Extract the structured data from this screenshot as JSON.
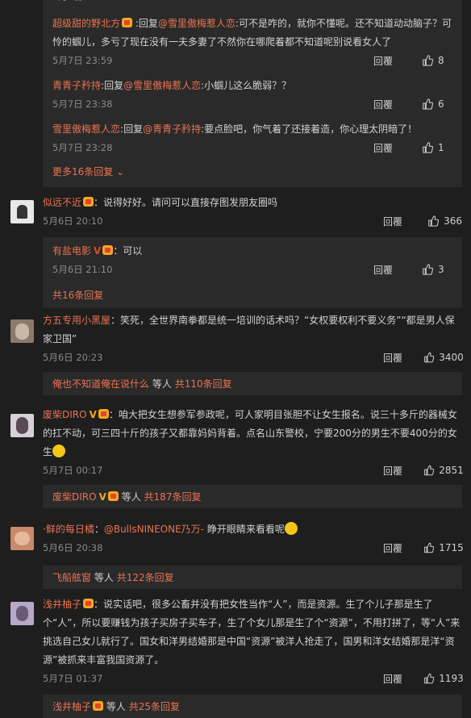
{
  "reply_label": "回覆",
  "nested_top": [
    {
      "name": "超级甜的野北方",
      "reply_prefix": "回复",
      "target": "@雪里傲梅惹人恋",
      "text": ":可不是咋的，就你不懂呢。还不知道动动脑子？可怜的蝈儿，多亏了现在没有一夫多妻了不然你在哪爬着都不知道呢别说看女人了",
      "time": "5月7日 23:59",
      "likes": "8"
    },
    {
      "name": "青青子矜持",
      "reply_prefix": "回复",
      "target": "@雪里傲梅惹人恋",
      "text": ":小蝈儿这么脆弱？？",
      "time": "5月7日 23:38",
      "likes": "6"
    },
    {
      "name": "雪里傲梅惹人恋",
      "reply_prefix": "回复",
      "target": "@青青子矜持",
      "text": ":要点脸吧，你气着了还接着造，你心理太阴暗了！",
      "time": "5月7日 23:28",
      "likes": "1"
    }
  ],
  "more_replies_top": "更多16条回复",
  "c1": {
    "name": "似远不近",
    "text": "说得好好。请问可以直接存图发朋友圈吗",
    "time": "5月6日 20:10",
    "likes": "366",
    "sub": {
      "name": "有盐电影",
      "text": "可以",
      "time": "5月6日 21:10",
      "likes": "3"
    },
    "more": "共16条回复"
  },
  "c2": {
    "name": "方五专用小黑屋",
    "text": "笑死，全世界南拳都是统一培训的话术吗？“女权要权利不要义务”“都是男人保家卫国”",
    "time": "5月6日 20:23",
    "likes": "3400",
    "summary_name": "俺也不知道俺在说什么",
    "summary_mid": "等人",
    "summary_count": "共110条回复"
  },
  "c3": {
    "name": "废柴DIRO",
    "text": "咱大把女生想参军参政呢，可人家明目张胆不让女生报名。说三十多斤的器械女的扛不动，可三四十斤的孩子又都靠妈妈背着。点名山东警校，宁要200分的男生不要400分的女生",
    "time": "5月7日 00:17",
    "likes": "2851",
    "summary_name": "废柴DIRO",
    "summary_mid": "等人",
    "summary_count": "共187条回复"
  },
  "c4": {
    "name": "·鲜的每日橘",
    "text": "@BullsNINEONE乃万-",
    "text2": "睁开眼睛来看看呢",
    "time": "5月6日 20:38",
    "likes": "1715",
    "summary_name": "飞船舷窗",
    "summary_mid": "等人",
    "summary_count": "共122条回复"
  },
  "c5": {
    "name": "浅井柚子",
    "text": "说实话吧，很多公畜并没有把女性当作“人”，而是资源。生了个儿子那是生了个“人”，所以要赚钱为孩子买房子买车子，生了个女儿那是生了个“资源”，不用打拼了，等“人”来挑选自己女儿就行了。国女和洋男结婚那是中国“资源”被洋人抢走了，国男和洋女结婚那是洋“资源”被抓来丰富我国资源了。",
    "time": "5月7日 01:37",
    "likes": "1193",
    "summary_name": "浅井柚子",
    "summary_mid": "等人",
    "summary_count": "共25条回复"
  }
}
